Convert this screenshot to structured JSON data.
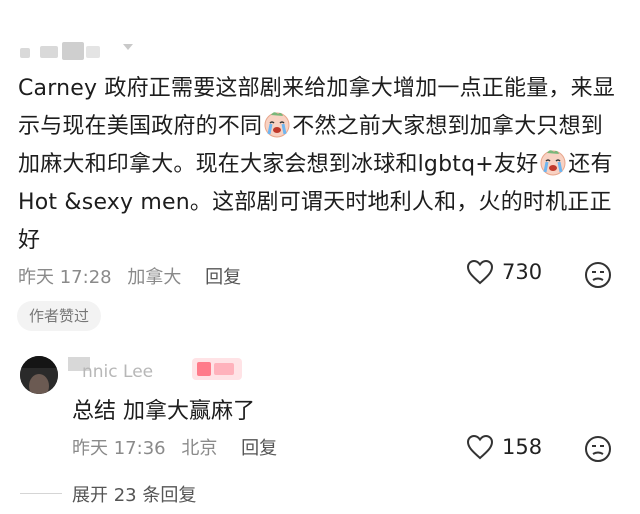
{
  "main_comment": {
    "segments": [
      "Carney 政府正需要这部剧来给加拿大增加一点正能量，来显示与现在美国政府的不同",
      "不然之前大家想到加拿大只想到加麻大和印拿大。现在大家会想到冰球和lgbtq+友好",
      "还有 Hot &sexy men。这部剧可谓天时地利人和，火的时机正正好"
    ],
    "time": "昨天 17:28",
    "location": "加拿大",
    "reply_label": "回复",
    "like_count": "730",
    "author_liked_label": "作者赞过"
  },
  "reply": {
    "user_name_partial": "nnic Lee",
    "text": "总结 加拿大赢麻了",
    "time": "昨天 17:36",
    "location": "北京",
    "reply_label": "回复",
    "like_count": "158"
  },
  "expand_replies_label": "展开 23 条回复",
  "colors": {
    "text": "#1d1d1d",
    "meta": "#8a8a8a",
    "badge_bg": "#ffe3e6",
    "emoji": "#f6c6b0"
  }
}
